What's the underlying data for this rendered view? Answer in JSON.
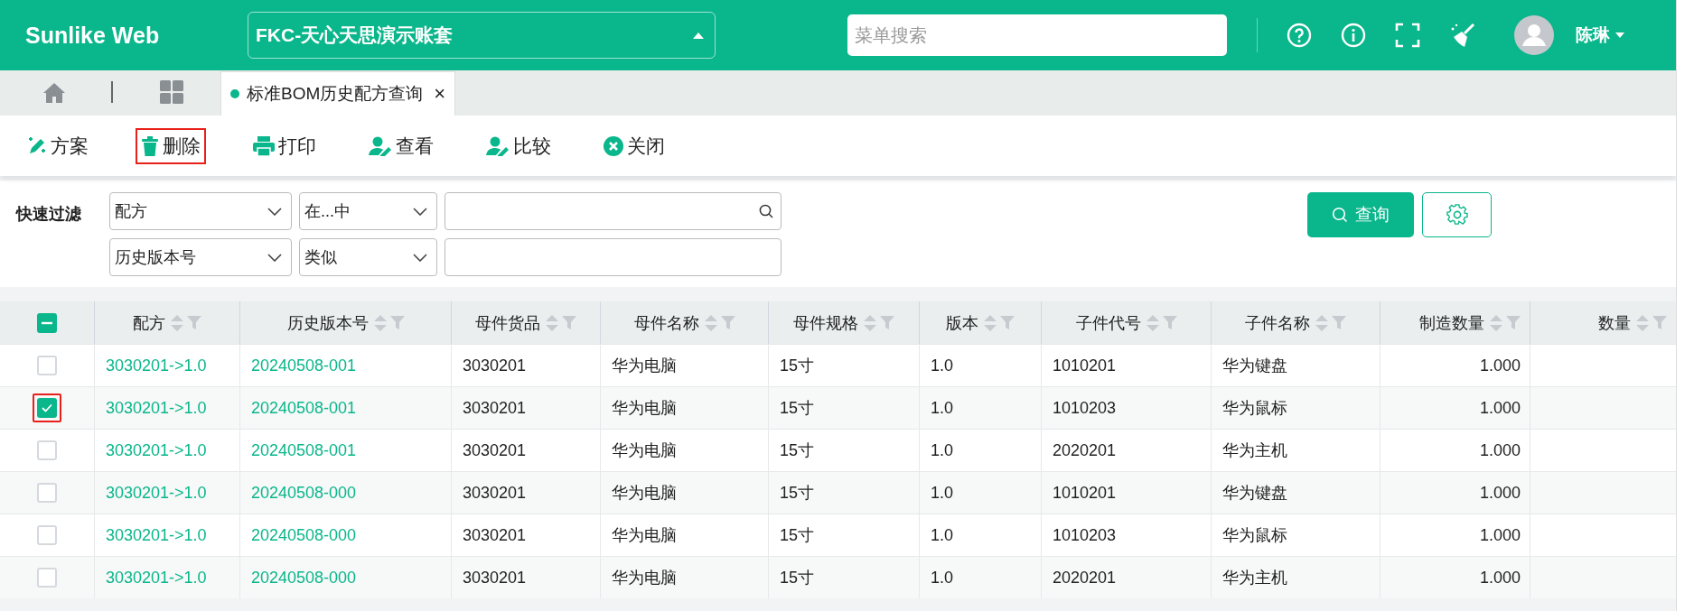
{
  "header": {
    "logo": "Sunlike Web",
    "account": "FKC-天心天思演示账套",
    "search": {
      "placeholder": "菜单搜索"
    },
    "user": "陈琳"
  },
  "tabs": [
    {
      "label": "标准BOM历史配方查询",
      "selected": true,
      "close": "×"
    }
  ],
  "toolbar": [
    {
      "label": "方案",
      "highlighted": false
    },
    {
      "label": "删除",
      "highlighted": true
    },
    {
      "label": "打印",
      "highlighted": false
    },
    {
      "label": "查看",
      "highlighted": false
    },
    {
      "label": "比较",
      "highlighted": false
    },
    {
      "label": "关闭",
      "highlighted": false
    }
  ],
  "filter": {
    "label": "快速过滤",
    "rows": [
      {
        "field": "配方",
        "operator": "在...中",
        "search": true
      },
      {
        "field": "历史版本号",
        "operator": "类似",
        "search": false
      }
    ],
    "query_button": "查询"
  },
  "table": {
    "select_all": {
      "indeterminate": true
    },
    "columns": [
      {
        "label": "配方",
        "kind": "link"
      },
      {
        "label": "历史版本号",
        "kind": "link"
      },
      {
        "label": "母件货品",
        "kind": "text"
      },
      {
        "label": "母件名称",
        "kind": "text"
      },
      {
        "label": "母件规格",
        "kind": "text"
      },
      {
        "label": "版本",
        "kind": "text"
      },
      {
        "label": "子件代号",
        "kind": "text"
      },
      {
        "label": "子件名称",
        "kind": "text"
      },
      {
        "label": "制造数量",
        "kind": "number"
      },
      {
        "label": "数量",
        "kind": "number"
      }
    ],
    "rows": [
      {
        "checked": false,
        "highlighted": false,
        "cells": [
          "3030201->1.0",
          "20240508-001",
          "3030201",
          "华为电脑",
          "15寸",
          "1.0",
          "1010201",
          "华为键盘",
          "1.000",
          ""
        ]
      },
      {
        "checked": true,
        "highlighted": true,
        "cells": [
          "3030201->1.0",
          "20240508-001",
          "3030201",
          "华为电脑",
          "15寸",
          "1.0",
          "1010203",
          "华为鼠标",
          "1.000",
          ""
        ]
      },
      {
        "checked": false,
        "highlighted": false,
        "cells": [
          "3030201->1.0",
          "20240508-001",
          "3030201",
          "华为电脑",
          "15寸",
          "1.0",
          "2020201",
          "华为主机",
          "1.000",
          ""
        ]
      },
      {
        "checked": false,
        "highlighted": false,
        "cells": [
          "3030201->1.0",
          "20240508-000",
          "3030201",
          "华为电脑",
          "15寸",
          "1.0",
          "1010201",
          "华为键盘",
          "1.000",
          ""
        ]
      },
      {
        "checked": false,
        "highlighted": false,
        "cells": [
          "3030201->1.0",
          "20240508-000",
          "3030201",
          "华为电脑",
          "15寸",
          "1.0",
          "1010203",
          "华为鼠标",
          "1.000",
          ""
        ]
      },
      {
        "checked": false,
        "highlighted": false,
        "cells": [
          "3030201->1.0",
          "20240508-000",
          "3030201",
          "华为电脑",
          "15寸",
          "1.0",
          "2020201",
          "华为主机",
          "1.000",
          ""
        ]
      }
    ]
  }
}
